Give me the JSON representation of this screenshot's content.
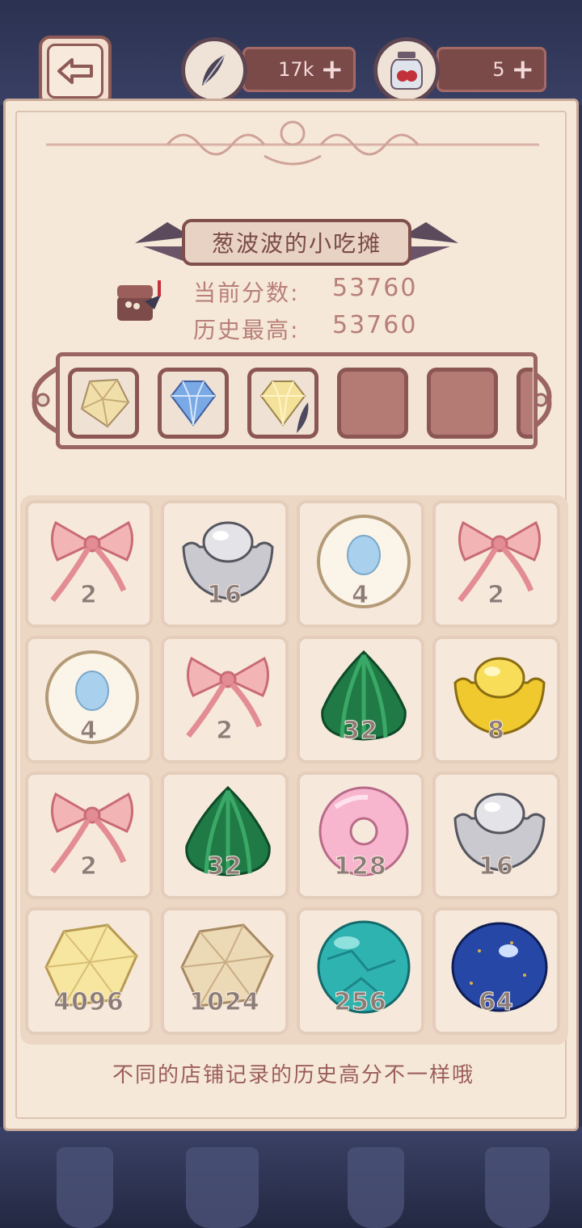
{
  "header": {
    "feather_count": "17k",
    "jar_count": "5",
    "plus": "+"
  },
  "shop": {
    "title": "葱波波的小吃摊",
    "current_score_label": "当前分数:",
    "current_score": "53760",
    "best_score_label": "历史最高:",
    "best_score": "53760"
  },
  "slots": [
    "yellow-crystal",
    "blue-diamond",
    "yellow-diamond",
    "empty",
    "empty",
    "empty"
  ],
  "grid": {
    "cells": [
      {
        "item": "ribbon-bow",
        "value": "2"
      },
      {
        "item": "silver-ingot",
        "value": "16"
      },
      {
        "item": "pearl-plate",
        "value": "4"
      },
      {
        "item": "ribbon-bow",
        "value": "2"
      },
      {
        "item": "pearl-plate",
        "value": "4"
      },
      {
        "item": "ribbon-bow",
        "value": "2"
      },
      {
        "item": "malachite",
        "value": "32"
      },
      {
        "item": "gold-ingot",
        "value": "8"
      },
      {
        "item": "ribbon-bow",
        "value": "2"
      },
      {
        "item": "malachite",
        "value": "32"
      },
      {
        "item": "pink-jade-ring",
        "value": "128"
      },
      {
        "item": "silver-ingot",
        "value": "16"
      },
      {
        "item": "citrine-crystal",
        "value": "4096"
      },
      {
        "item": "champagne-crystal",
        "value": "1024"
      },
      {
        "item": "turquoise",
        "value": "256"
      },
      {
        "item": "lapis-lazuli",
        "value": "64"
      }
    ]
  },
  "footer": {
    "hint": "不同的店铺记录的历史高分不一样哦"
  },
  "colors": {
    "panel": "#f6e8d8",
    "accent": "#7a4a48",
    "text": "#b77f78"
  }
}
